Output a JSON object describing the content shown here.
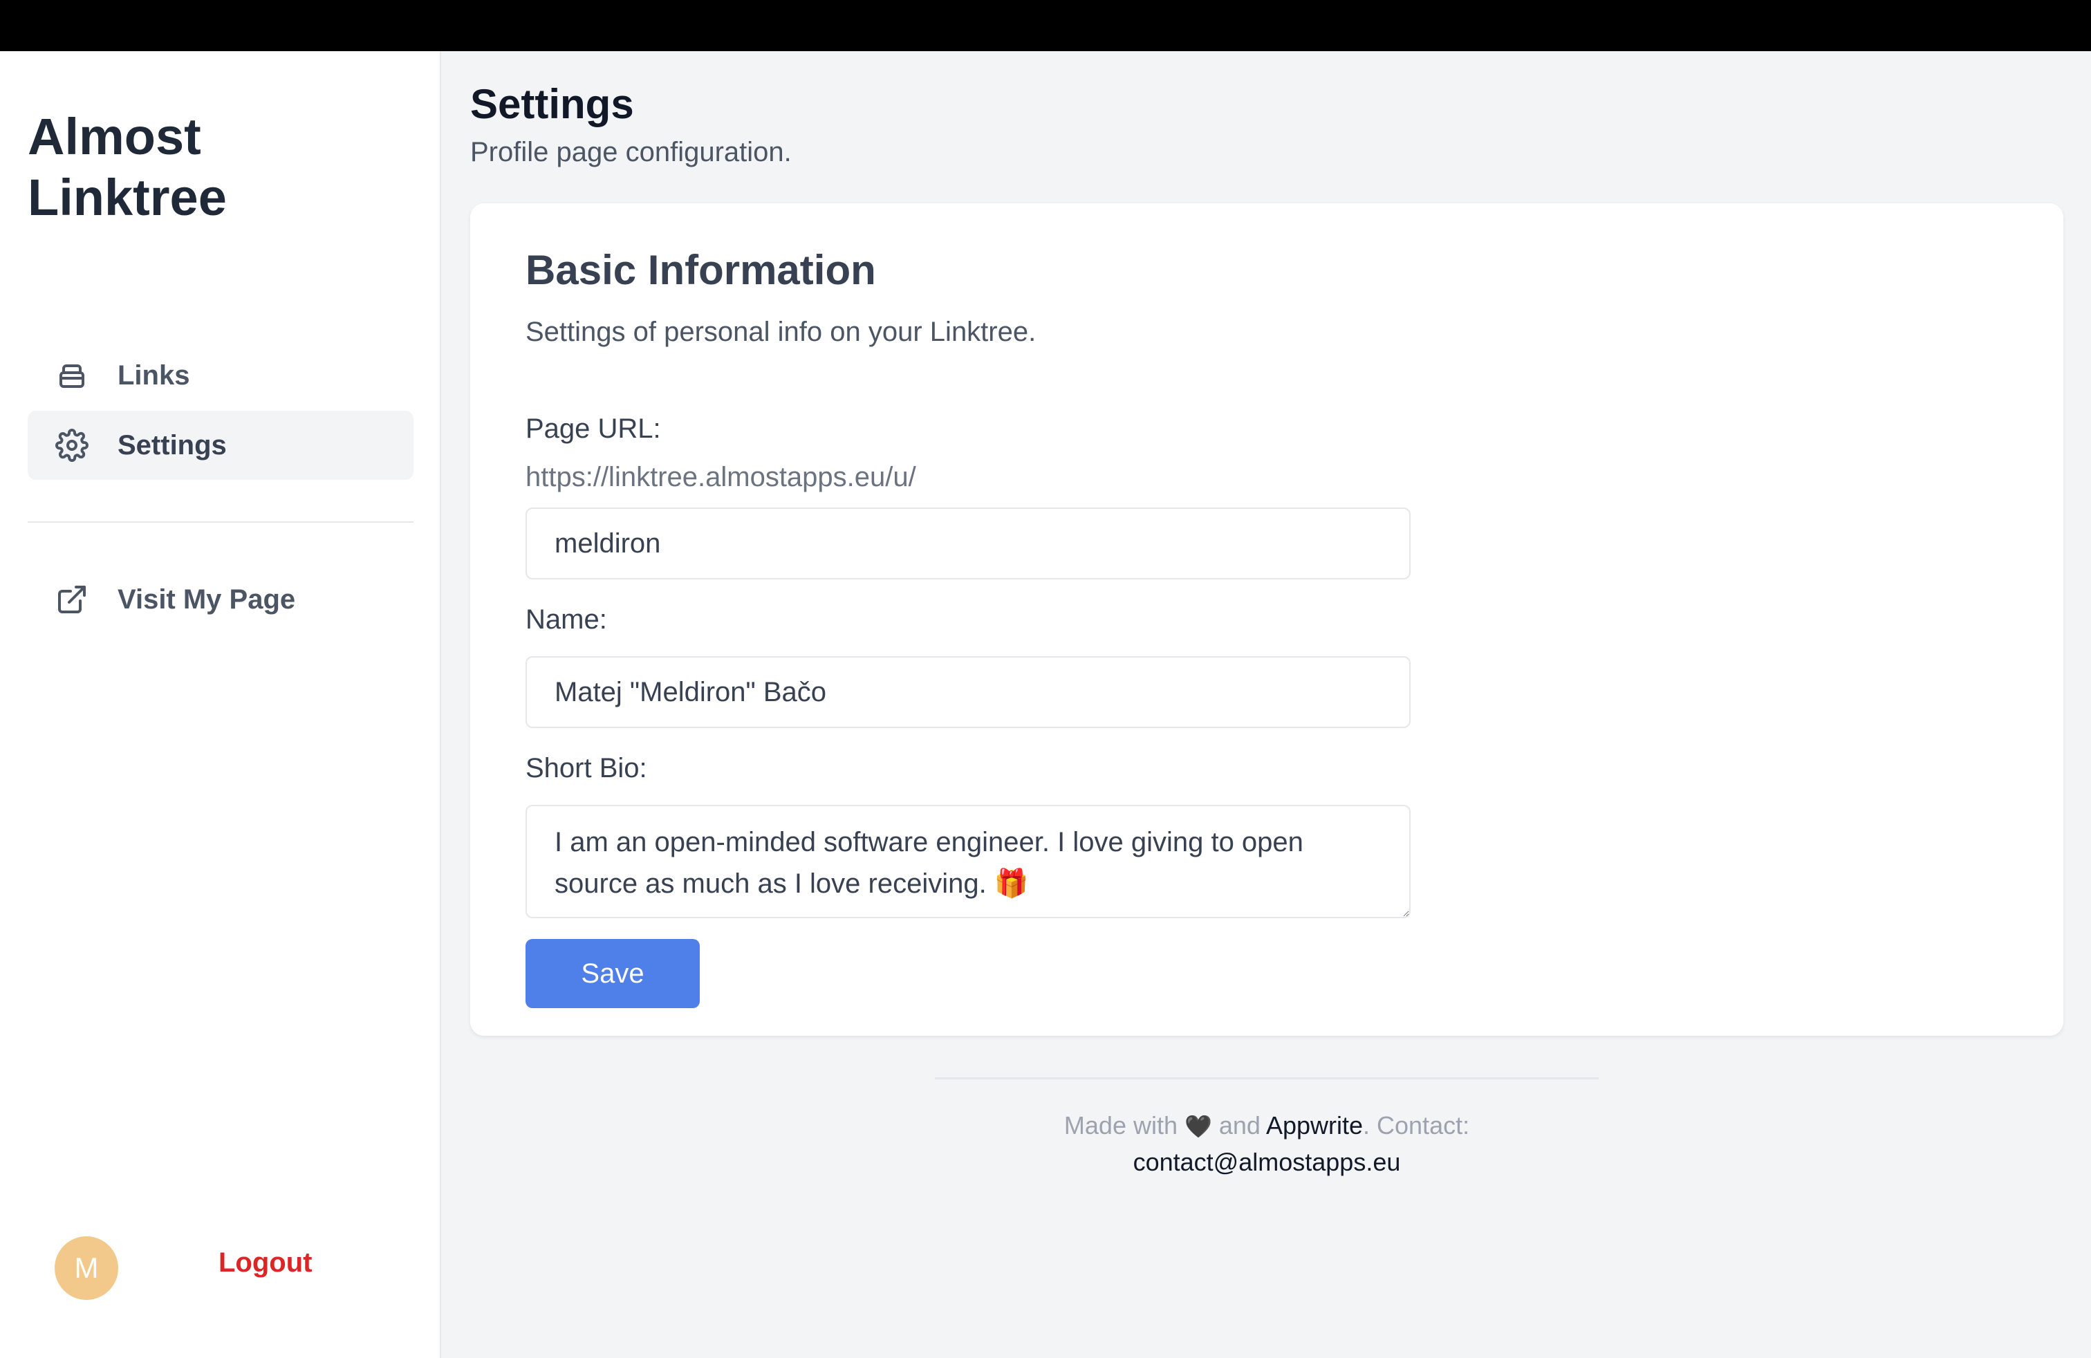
{
  "app": {
    "brand_line1": "Almost",
    "brand_line2": "Linktree"
  },
  "sidebar": {
    "items": [
      {
        "label": "Links",
        "icon": "archive-icon",
        "active": false
      },
      {
        "label": "Settings",
        "icon": "gear-icon",
        "active": true
      },
      {
        "label": "Visit My Page",
        "icon": "external-link-icon",
        "active": false
      }
    ],
    "avatar_initial": "M",
    "logout_label": "Logout"
  },
  "header": {
    "title": "Settings",
    "subtitle": "Profile page configuration."
  },
  "card": {
    "title": "Basic Information",
    "description": "Settings of personal info on your Linktree.",
    "page_url_label": "Page URL:",
    "page_url_prefix": "https://linktree.almostapps.eu/u/",
    "page_url_value": "meldiron",
    "name_label": "Name:",
    "name_value": "Matej \"Meldiron\" Bačo",
    "bio_label": "Short Bio:",
    "bio_value": "I am an open-minded software engineer. I love giving to open source as much as I love receiving. 🎁",
    "save_label": "Save"
  },
  "footer": {
    "made_with": "Made with",
    "heart": "🖤",
    "and": "and",
    "appwrite": "Appwrite",
    "contact_label": ". Contact:",
    "email": "contact@almostapps.eu"
  },
  "colors": {
    "accent": "#4f7fe8",
    "logout": "#dc2626",
    "avatar": "#f3c98b"
  }
}
